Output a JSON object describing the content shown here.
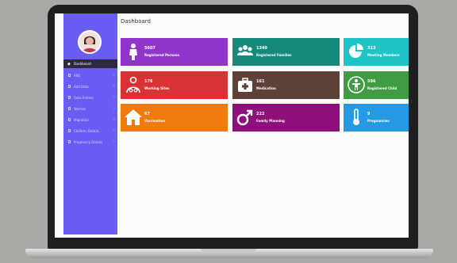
{
  "page_title": "Dashboard",
  "sidebar": {
    "active_item": "Dashboard",
    "items": [
      {
        "label": "ANC"
      },
      {
        "label": "Add Data"
      },
      {
        "label": "Data Entries"
      },
      {
        "label": "Women"
      },
      {
        "label": "Migration"
      },
      {
        "label": "Children Details"
      },
      {
        "label": "Pregnancy Details"
      }
    ]
  },
  "cards": [
    {
      "value": "5607",
      "label": "Registered Persons",
      "color": "#8f35cc",
      "icon": "person-icon"
    },
    {
      "value": "1349",
      "label": "Registered Families",
      "color": "#16897a",
      "icon": "family-icon"
    },
    {
      "value": "313",
      "label": "Meeting Members",
      "color": "#1fc4c6",
      "icon": "pie-chart-icon"
    },
    {
      "value": "176",
      "label": "Working Sites",
      "color": "#d83234",
      "icon": "doctor-icon"
    },
    {
      "value": "161",
      "label": "Medication",
      "color": "#5d4037",
      "icon": "medical-kit-icon"
    },
    {
      "value": "596",
      "label": "Registered Child",
      "color": "#3f9c42",
      "icon": "child-icon"
    },
    {
      "value": "67",
      "label": "Vaccination",
      "color": "#ef7b0e",
      "icon": "home-icon"
    },
    {
      "value": "222",
      "label": "Family Planning",
      "color": "#8f0f7d",
      "icon": "male-icon"
    },
    {
      "value": "9",
      "label": "Pregnancies",
      "color": "#249ae4",
      "icon": "thermometer-icon"
    }
  ]
}
